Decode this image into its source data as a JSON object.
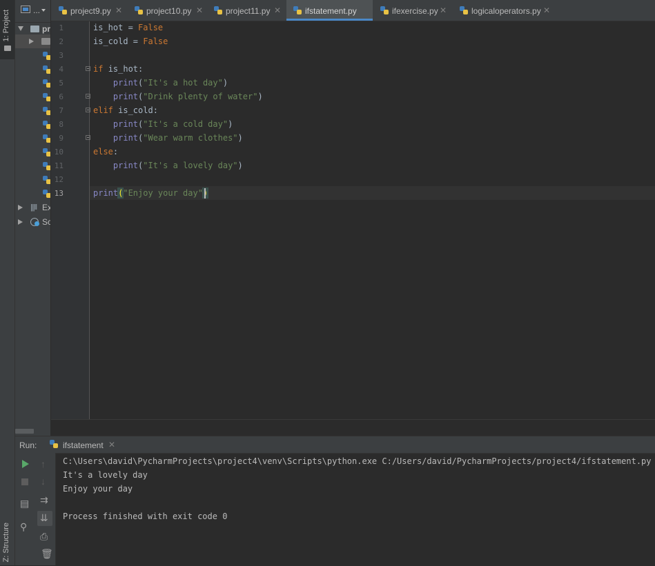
{
  "left_strip": {
    "project_label": "1: Project",
    "structure_label": "Z: Structure"
  },
  "project_tree": {
    "root_label": "pr",
    "items": [
      {
        "label": "Ex"
      },
      {
        "label": "Sc"
      }
    ]
  },
  "tabs": [
    {
      "label": "project9.py",
      "active": false
    },
    {
      "label": "project10.py",
      "active": false
    },
    {
      "label": "project11.py",
      "active": false
    },
    {
      "label": "ifstatement.py",
      "active": true
    },
    {
      "label": "ifexercise.py",
      "active": false
    },
    {
      "label": "logicaloperators.py",
      "active": false
    }
  ],
  "tab_dots": "...",
  "editor": {
    "line_numbers": [
      "1",
      "2",
      "3",
      "4",
      "5",
      "6",
      "7",
      "8",
      "9",
      "10",
      "11",
      "12",
      "13"
    ],
    "current_line": "13",
    "lines": [
      {
        "parts": [
          {
            "t": "is_hot = ",
            "c": "plain"
          },
          {
            "t": "False",
            "c": "kw"
          }
        ]
      },
      {
        "parts": [
          {
            "t": "is_cold = ",
            "c": "plain"
          },
          {
            "t": "False",
            "c": "kw"
          }
        ]
      },
      {
        "parts": []
      },
      {
        "parts": [
          {
            "t": "if ",
            "c": "kw"
          },
          {
            "t": "is_hot:",
            "c": "plain"
          }
        ]
      },
      {
        "parts": [
          {
            "t": "    ",
            "c": "plain"
          },
          {
            "t": "print",
            "c": "fn"
          },
          {
            "t": "(",
            "c": "plain"
          },
          {
            "t": "\"It's a hot day\"",
            "c": "str"
          },
          {
            "t": ")",
            "c": "plain"
          }
        ]
      },
      {
        "parts": [
          {
            "t": "    ",
            "c": "plain"
          },
          {
            "t": "print",
            "c": "fn"
          },
          {
            "t": "(",
            "c": "plain"
          },
          {
            "t": "\"Drink plenty of water\"",
            "c": "str"
          },
          {
            "t": ")",
            "c": "plain"
          }
        ]
      },
      {
        "parts": [
          {
            "t": "elif ",
            "c": "kw"
          },
          {
            "t": "is_cold:",
            "c": "plain"
          }
        ]
      },
      {
        "parts": [
          {
            "t": "    ",
            "c": "plain"
          },
          {
            "t": "print",
            "c": "fn"
          },
          {
            "t": "(",
            "c": "plain"
          },
          {
            "t": "\"It's a cold day\"",
            "c": "str"
          },
          {
            "t": ")",
            "c": "plain"
          }
        ]
      },
      {
        "parts": [
          {
            "t": "    ",
            "c": "plain"
          },
          {
            "t": "print",
            "c": "fn"
          },
          {
            "t": "(",
            "c": "plain"
          },
          {
            "t": "\"Wear warm clothes\"",
            "c": "str"
          },
          {
            "t": ")",
            "c": "plain"
          }
        ]
      },
      {
        "parts": [
          {
            "t": "else",
            "c": "kw"
          },
          {
            "t": ":",
            "c": "plain"
          }
        ]
      },
      {
        "parts": [
          {
            "t": "    ",
            "c": "plain"
          },
          {
            "t": "print",
            "c": "fn"
          },
          {
            "t": "(",
            "c": "plain"
          },
          {
            "t": "\"It's a lovely day\"",
            "c": "str"
          },
          {
            "t": ")",
            "c": "plain"
          }
        ]
      },
      {
        "parts": []
      },
      {
        "parts": [
          {
            "t": "print",
            "c": "fn"
          },
          {
            "t": "(",
            "c": "brace"
          },
          {
            "t": "\"Enjoy your day\"",
            "c": "str"
          },
          {
            "t": ")",
            "c": "brace"
          }
        ]
      }
    ]
  },
  "run": {
    "label": "Run:",
    "tab_label": "ifstatement",
    "output": [
      "C:\\Users\\david\\PycharmProjects\\project4\\venv\\Scripts\\python.exe C:/Users/david/PycharmProjects/project4/ifstatement.py",
      "It's a lovely day",
      "Enjoy your day",
      "",
      "Process finished with exit code 0"
    ]
  },
  "colors": {
    "keyword": "#cc7832",
    "string": "#6a8759",
    "builtin": "#8888c6",
    "accent": "#4a88c7",
    "run_green": "#59a869"
  }
}
